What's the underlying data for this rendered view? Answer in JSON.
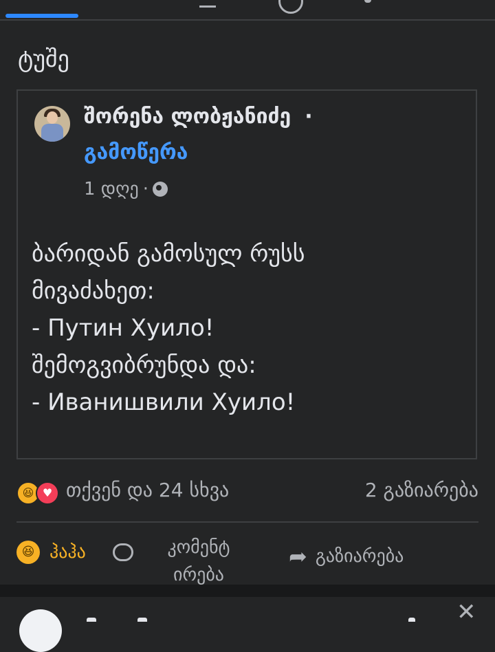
{
  "post": {
    "text": "ტუშე"
  },
  "shared": {
    "author": "შორენა ლობჟანიძე",
    "dot": "·",
    "follow_label": "გამოწერა",
    "time": "1 დღე",
    "meta_sep": "·",
    "privacy_icon": "globe-icon",
    "lines": [
      "ბარიდან გამოსულ რუსს",
      "მივაძახეთ:",
      "- Путин Хуило!",
      "შემოგვიბრუნდა და:",
      "- Иванишвили Хуило!"
    ]
  },
  "reactions": {
    "summary": "თქვენ და 24 სხვა",
    "shares": "2 გაზიარება",
    "icons": [
      "haha-icon",
      "love-icon"
    ]
  },
  "actions": {
    "haha": "ჰაჰა",
    "comment_line1": "კომენტ",
    "comment_line2": "ირება",
    "share": "გაზიარება"
  },
  "colors": {
    "background": "#242526",
    "accent": "#2d88ff",
    "follow": "#4599ff",
    "haha": "#f7b125",
    "love": "#f33e58",
    "muted": "#b0b3b8"
  },
  "next_post": {
    "close_icon": "close-icon"
  }
}
